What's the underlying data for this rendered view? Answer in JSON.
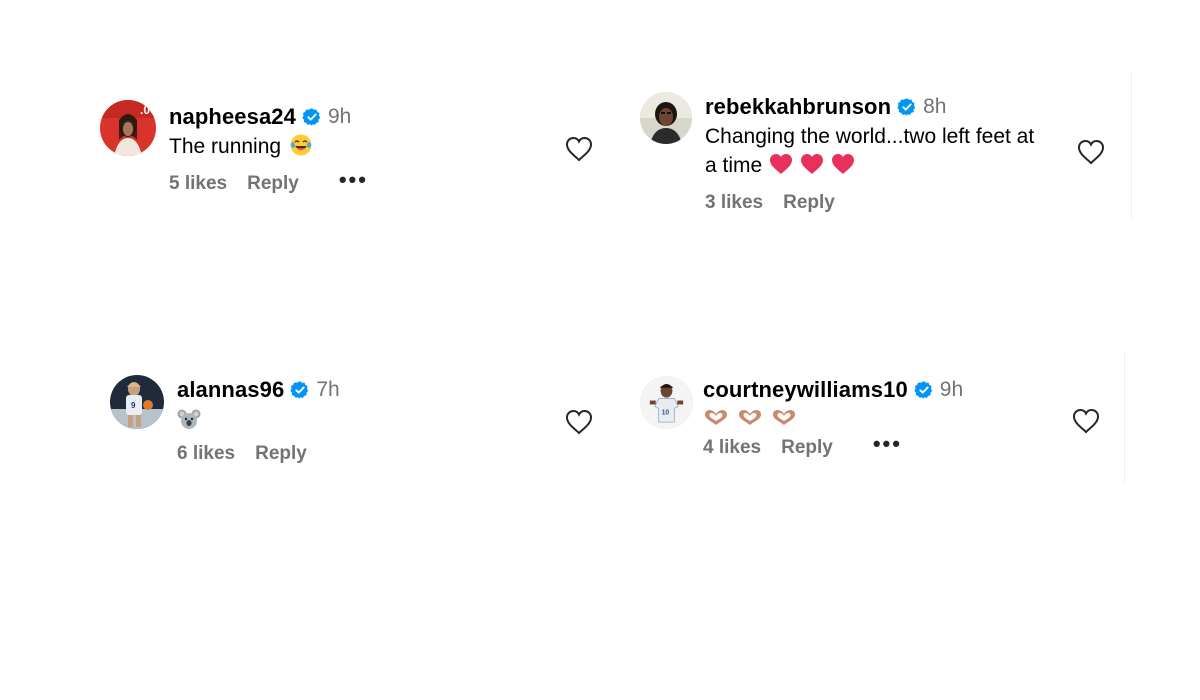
{
  "comments": [
    {
      "username": "napheesa24",
      "time": "9h",
      "text": "The running",
      "emoji": "laughing-tears",
      "likes": "5 likes",
      "reply": "Reply",
      "more": "•••"
    },
    {
      "username": "rebekkahbrunson",
      "time": "8h",
      "text_line1": "Changing the world...two left feet at",
      "text_line2": "a time",
      "emoji": "red-heart x3",
      "likes": "3 likes",
      "reply": "Reply"
    },
    {
      "username": "alannas96",
      "time": "7h",
      "emoji": "koala",
      "likes": "6 likes",
      "reply": "Reply"
    },
    {
      "username": "courtneywilliams10",
      "time": "9h",
      "emoji": "heart-hands x3",
      "likes": "4 likes",
      "reply": "Reply",
      "more": "•••"
    }
  ],
  "colors": {
    "verified": "#0095f6",
    "muted": "#737373",
    "heart_emoji": "#e8305c",
    "heart_outline": "#262626"
  }
}
